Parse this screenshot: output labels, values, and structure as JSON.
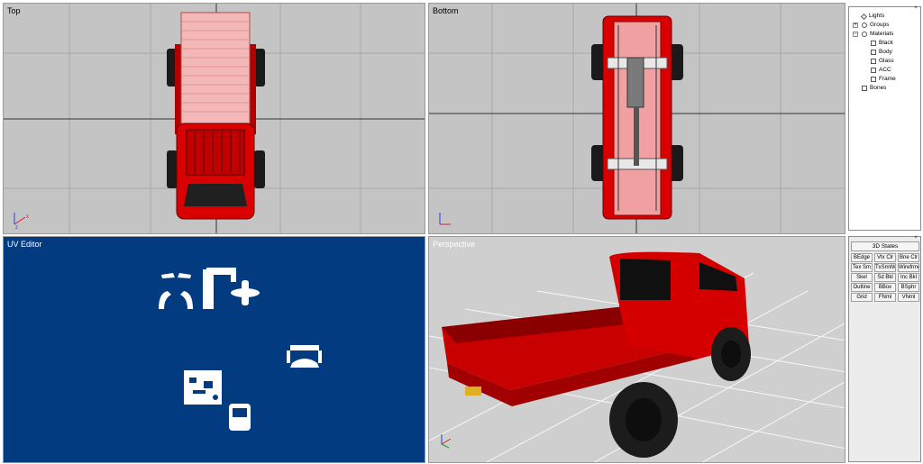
{
  "viewports": {
    "top": {
      "label": "Top"
    },
    "bottom": {
      "label": "Bottom"
    },
    "uv": {
      "label": "UV Editor"
    },
    "perspective": {
      "label": "Perspective"
    }
  },
  "scene_tree": {
    "items": [
      {
        "label": "Lights",
        "icon": "light-icon"
      },
      {
        "label": "Groups",
        "icon": "group-icon"
      },
      {
        "label": "Materials",
        "icon": "material-icon"
      },
      {
        "label": "Black",
        "icon": "material-swatch-icon"
      },
      {
        "label": "Body",
        "icon": "material-swatch-icon"
      },
      {
        "label": "Glass",
        "icon": "material-swatch-icon"
      },
      {
        "label": "ACC",
        "icon": "material-swatch-icon"
      },
      {
        "label": "Frame",
        "icon": "material-swatch-icon"
      },
      {
        "label": "Bones",
        "icon": "bone-icon"
      }
    ]
  },
  "tools": {
    "states_label": "3D States",
    "buttons": [
      "BEdge",
      "Vtx Clr",
      "Bne Clr",
      "Tex Sm",
      "TxSmWr",
      "Wirefrme",
      "Skel",
      "Sd Bkl",
      "Inc Bkl",
      "Outline",
      "BBox",
      "BSphr",
      "Grid",
      "FNml",
      "VNml"
    ]
  },
  "colors": {
    "viewport_bg": "#c4c4c4",
    "uv_bg": "#023b80",
    "model_red": "#e00000",
    "axis_x": "#e02020",
    "axis_y": "#20a020",
    "axis_z": "#2040e0"
  }
}
